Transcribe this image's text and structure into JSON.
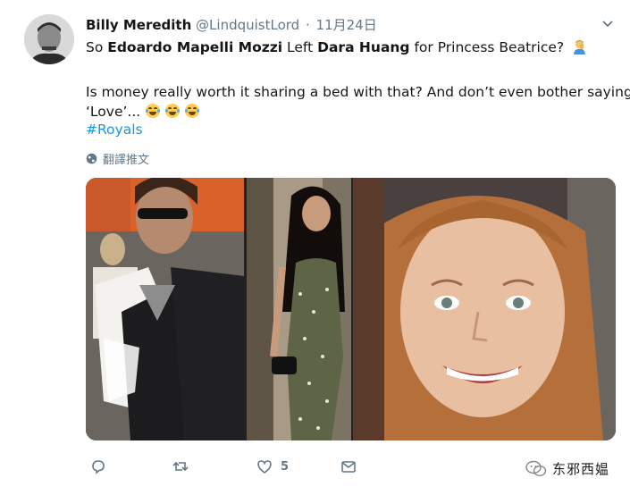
{
  "tweet": {
    "author": {
      "display_name": "Billy Meredith",
      "handle": "@LindquistLord"
    },
    "separator": "·",
    "time": "11月24日",
    "lines": {
      "l1a": "So ",
      "l1b": "Edoardo Mapelli Mozzi",
      "l1c": " Left ",
      "l1d": "Dara Huang",
      "l1e": " for Princess Beatrice?",
      "l2": "Is money really worth it sharing a bed with that? And don’t even bother saying it’s",
      "l3": "‘Love’..."
    },
    "hashtag": "#Royals",
    "translate_label": "翻譯推文",
    "actions": {
      "reply_count": "",
      "retweet_count": "",
      "like_count": "5"
    }
  },
  "watermark": {
    "text": "东邪西媪"
  },
  "icons": {
    "avatar": "avatar-photo",
    "more": "chevron-down-icon",
    "emoji_person": "facepalm-emoji-icon",
    "emoji_laugh": "tears-of-joy-emoji-icon",
    "translate": "globe-icon",
    "reply": "reply-icon",
    "retweet": "retweet-icon",
    "like": "heart-icon",
    "dm": "envelope-icon"
  },
  "colors": {
    "text": "#14171a",
    "secondary": "#657786",
    "link": "#1b95e0"
  }
}
